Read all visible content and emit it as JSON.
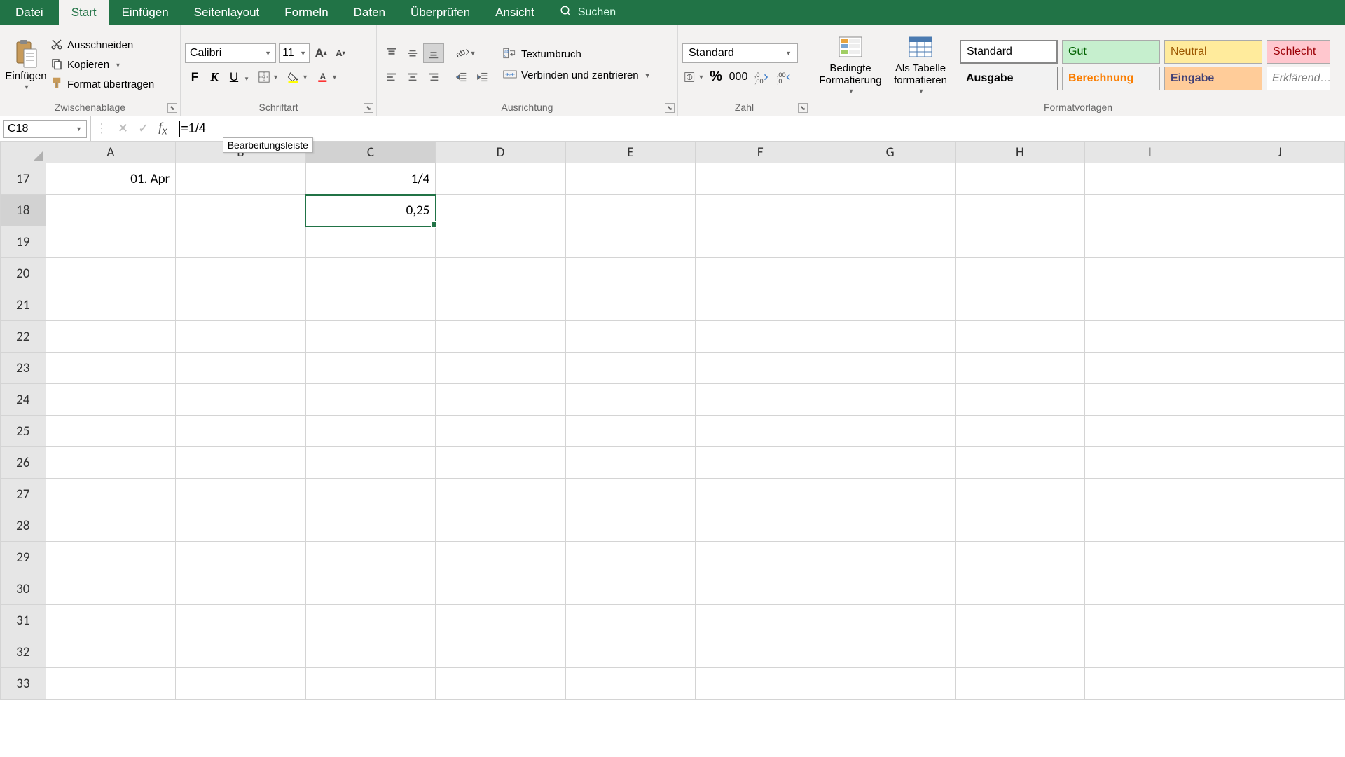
{
  "tabs": {
    "file": "Datei",
    "start": "Start",
    "insert": "Einfügen",
    "layout": "Seitenlayout",
    "formulas": "Formeln",
    "data": "Daten",
    "review": "Überprüfen",
    "view": "Ansicht",
    "search_placeholder": "Suchen"
  },
  "ribbon": {
    "clipboard": {
      "paste": "Einfügen",
      "cut": "Ausschneiden",
      "copy": "Kopieren",
      "format_painter": "Format übertragen",
      "label": "Zwischenablage"
    },
    "font": {
      "name": "Calibri",
      "size": "11",
      "bold": "F",
      "italic": "K",
      "underline": "U",
      "label": "Schriftart"
    },
    "alignment": {
      "wrap": "Textumbruch",
      "merge": "Verbinden und zentrieren",
      "label": "Ausrichtung"
    },
    "number": {
      "format": "Standard",
      "label": "Zahl"
    },
    "styles": {
      "conditional": "Bedingte Formatierung",
      "as_table": "Als Tabelle formatieren",
      "standard": "Standard",
      "gut": "Gut",
      "neutral": "Neutral",
      "schlecht": "Schlecht",
      "ausgabe": "Ausgabe",
      "berechnung": "Berechnung",
      "eingabe": "Eingabe",
      "erkl": "Erklärend…",
      "label": "Formatvorlagen"
    }
  },
  "formula_bar": {
    "cell_ref": "C18",
    "formula": "=1/4",
    "tooltip": "Bearbeitungsleiste"
  },
  "columns": [
    "A",
    "B",
    "C",
    "D",
    "E",
    "F",
    "G",
    "H",
    "I",
    "J"
  ],
  "rows": [
    17,
    18,
    19,
    20,
    21,
    22,
    23,
    24,
    25,
    26,
    27,
    28,
    29,
    30,
    31,
    32,
    33
  ],
  "cells": {
    "A17": "01. Apr",
    "C17": "1/4",
    "C18": "0,25"
  },
  "selection": {
    "col": "C",
    "row": 18
  }
}
